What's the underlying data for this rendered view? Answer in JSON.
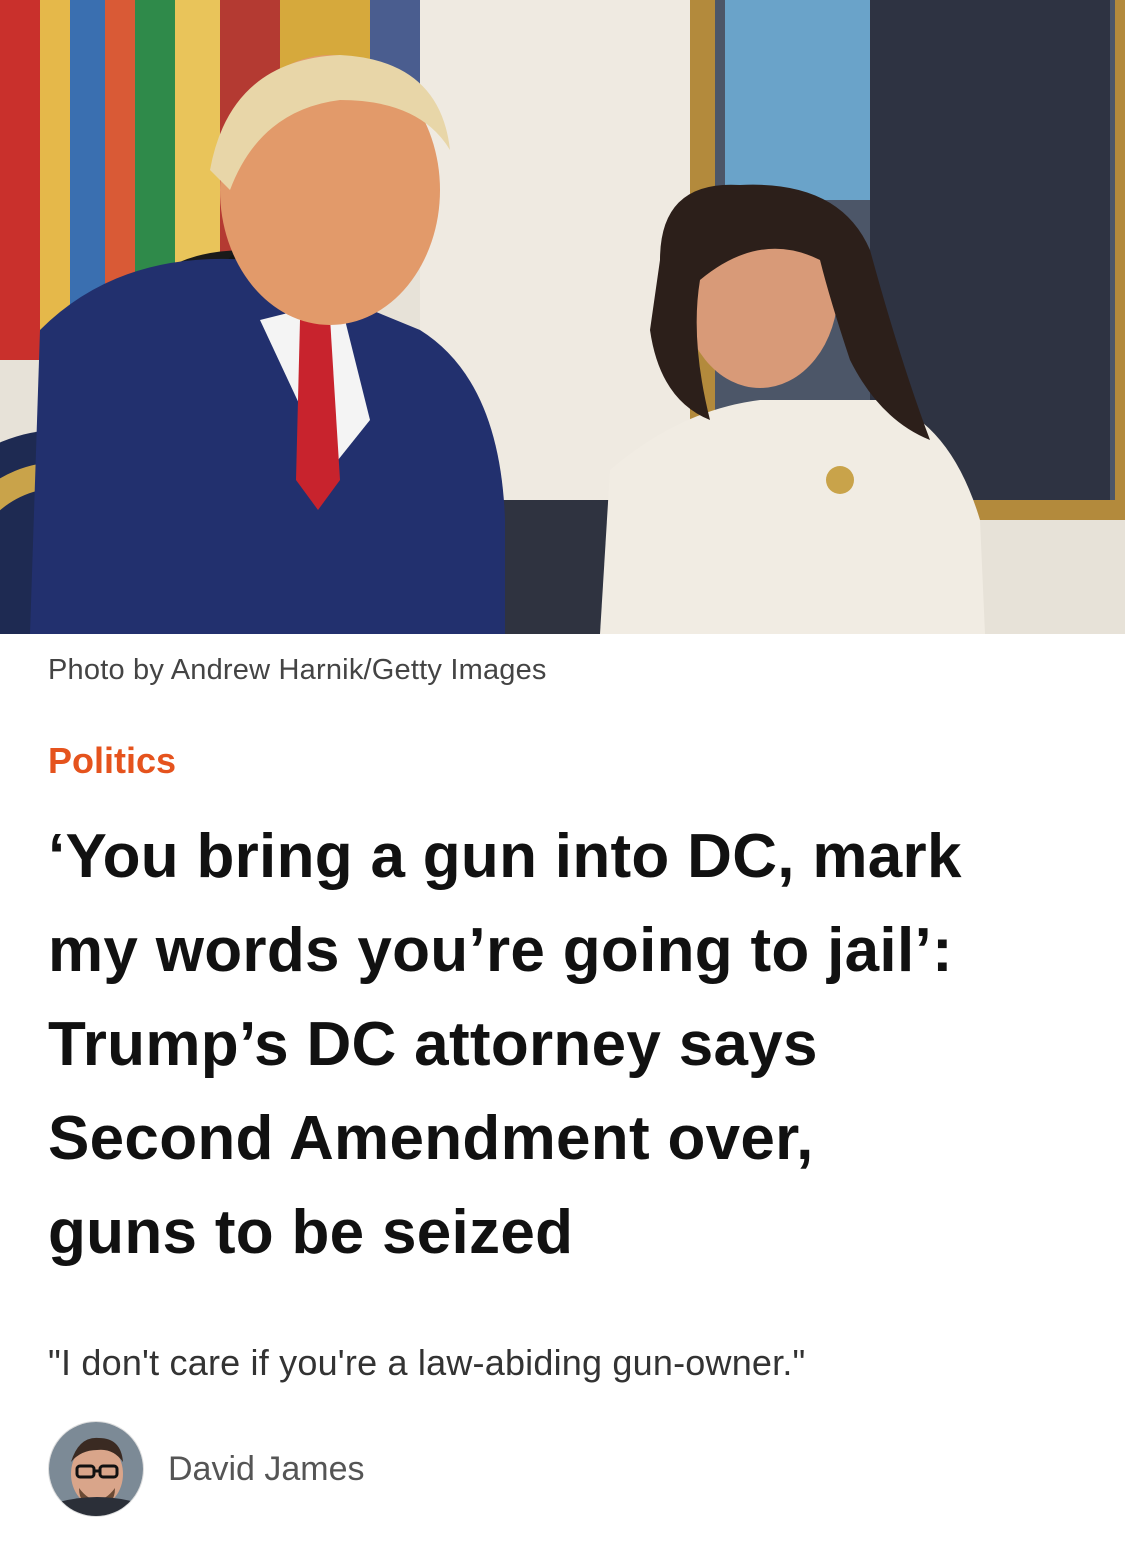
{
  "hero": {
    "alt_icon": "photo-image"
  },
  "caption": "Photo by Andrew Harnik/Getty Images",
  "category": "Politics",
  "headline_lines": [
    "‘You bring a gun into DC, mark",
    "my words you’re going to jail’:",
    "Trump’s DC attorney says",
    "Second Amendment over,",
    "guns to be seized"
  ],
  "subhead": "\"I don't care if you're a law-abiding gun-owner.\"",
  "author": {
    "name": "David James"
  },
  "colors": {
    "category": "#e5531d",
    "headline": "#111111"
  }
}
